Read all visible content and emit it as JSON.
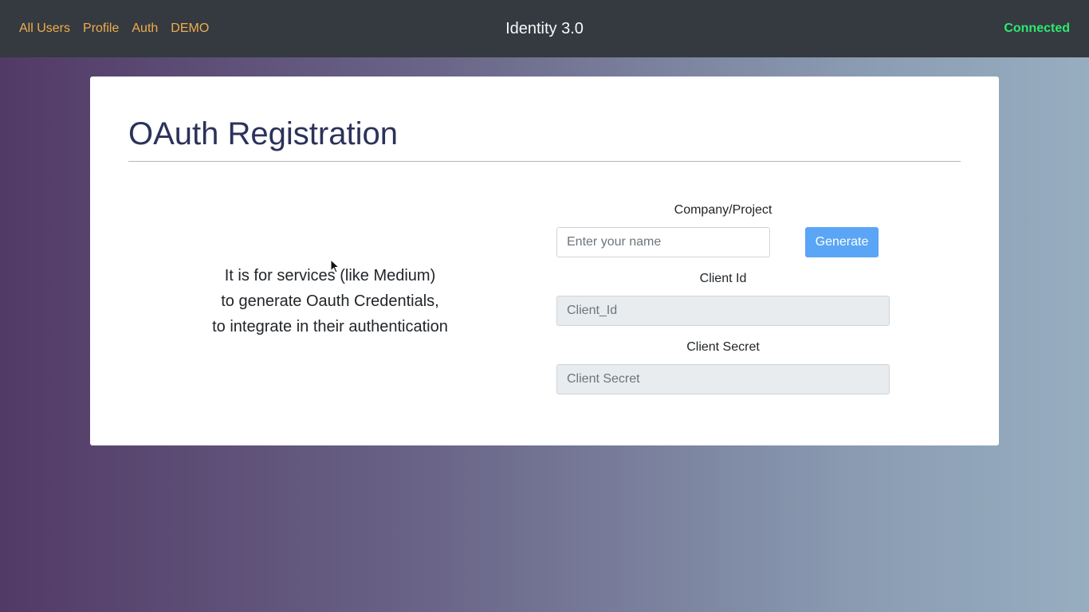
{
  "nav": {
    "links": [
      {
        "label": "All Users"
      },
      {
        "label": "Profile"
      },
      {
        "label": "Auth"
      },
      {
        "label": "DEMO"
      }
    ],
    "brand": "Identity 3.0",
    "status": "Connected"
  },
  "page": {
    "title": "OAuth Registration",
    "description": [
      "It is for services (like Medium)",
      "to generate Oauth Credentials,",
      "to integrate in their authentication"
    ]
  },
  "form": {
    "company_label": "Company/Project",
    "company_placeholder": "Enter your name",
    "company_value": "",
    "generate_label": "Generate",
    "client_id_label": "Client Id",
    "client_id_placeholder": "Client_Id",
    "client_secret_label": "Client Secret",
    "client_secret_placeholder": "Client Secret"
  },
  "colors": {
    "navbar_bg": "#343a40",
    "nav_link": "#f0ad4e",
    "status_connected": "#2ee870",
    "title": "#2c325a",
    "button_primary": "#5aa5f5"
  },
  "icons": {
    "cursor": "mouse-pointer-icon"
  }
}
